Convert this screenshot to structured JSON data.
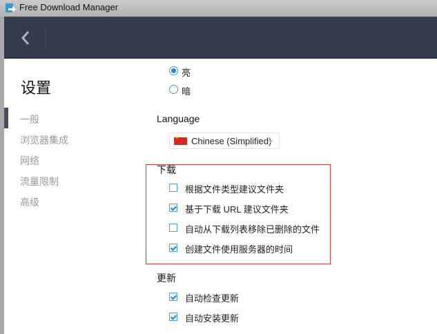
{
  "window": {
    "title": "Free Download Manager"
  },
  "sidebar": {
    "title": "设置",
    "items": [
      {
        "label": "一般"
      },
      {
        "label": "浏览器集成"
      },
      {
        "label": "网络"
      },
      {
        "label": "流量限制"
      },
      {
        "label": "高级"
      }
    ],
    "active": 0
  },
  "theme": {
    "options": [
      {
        "label": "亮",
        "selected": true
      },
      {
        "label": "暗",
        "selected": false
      }
    ]
  },
  "language": {
    "heading": "Language",
    "selected": "Chinese (Simplified)"
  },
  "downloads": {
    "heading": "下载",
    "items": [
      {
        "label": "根据文件类型建议文件夹",
        "checked": false
      },
      {
        "label": "基于下载 URL 建议文件夹",
        "checked": true
      },
      {
        "label": "自动从下载列表移除已删除的文件",
        "checked": false
      },
      {
        "label": "创建文件使用服务器的时间",
        "checked": true
      }
    ]
  },
  "updates": {
    "heading": "更新",
    "items": [
      {
        "label": "自动检查更新",
        "checked": true
      },
      {
        "label": "自动安装更新",
        "checked": true
      }
    ]
  },
  "colors": {
    "header": "#343b4d",
    "accent": "#1e88d6",
    "highlight_box": "#cf3b3b"
  }
}
